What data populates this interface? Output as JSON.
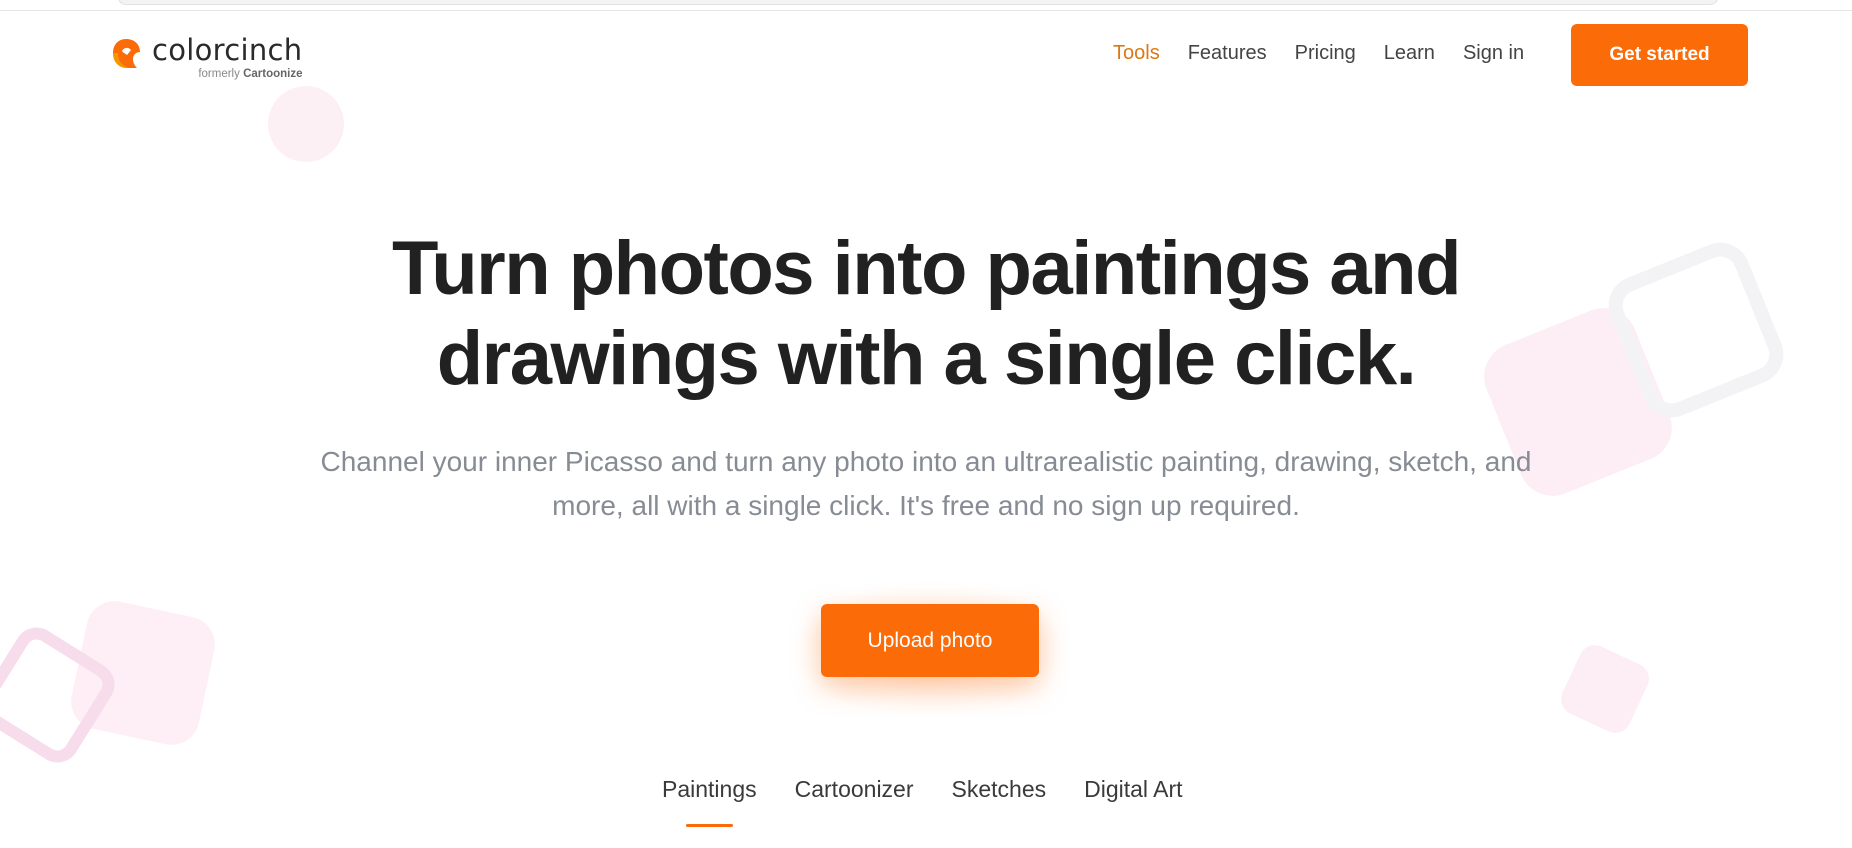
{
  "brand": {
    "name": "colorcinch",
    "formerly_prefix": "formerly",
    "formerly_name": "Cartoonize",
    "accent_color": "#fb6b07",
    "active_nav_color": "#d97a12"
  },
  "nav": {
    "links": [
      {
        "label": "Tools",
        "active": true
      },
      {
        "label": "Features",
        "active": false
      },
      {
        "label": "Pricing",
        "active": false
      },
      {
        "label": "Learn",
        "active": false
      },
      {
        "label": "Sign in",
        "active": false
      }
    ],
    "cta_label": "Get started"
  },
  "hero": {
    "title_line1": "Turn photos into paintings and",
    "title_line2": "drawings with a single click.",
    "subtitle_line1": "Channel your inner Picasso and turn any photo into an ultrarealistic painting, drawing, sketch, and",
    "subtitle_line2": "more, all with a single click. It's free and no sign up required.",
    "upload_label": "Upload photo"
  },
  "tabs": [
    {
      "label": "Paintings",
      "active": true
    },
    {
      "label": "Cartoonizer",
      "active": false
    },
    {
      "label": "Sketches",
      "active": false
    },
    {
      "label": "Digital Art",
      "active": false
    }
  ]
}
